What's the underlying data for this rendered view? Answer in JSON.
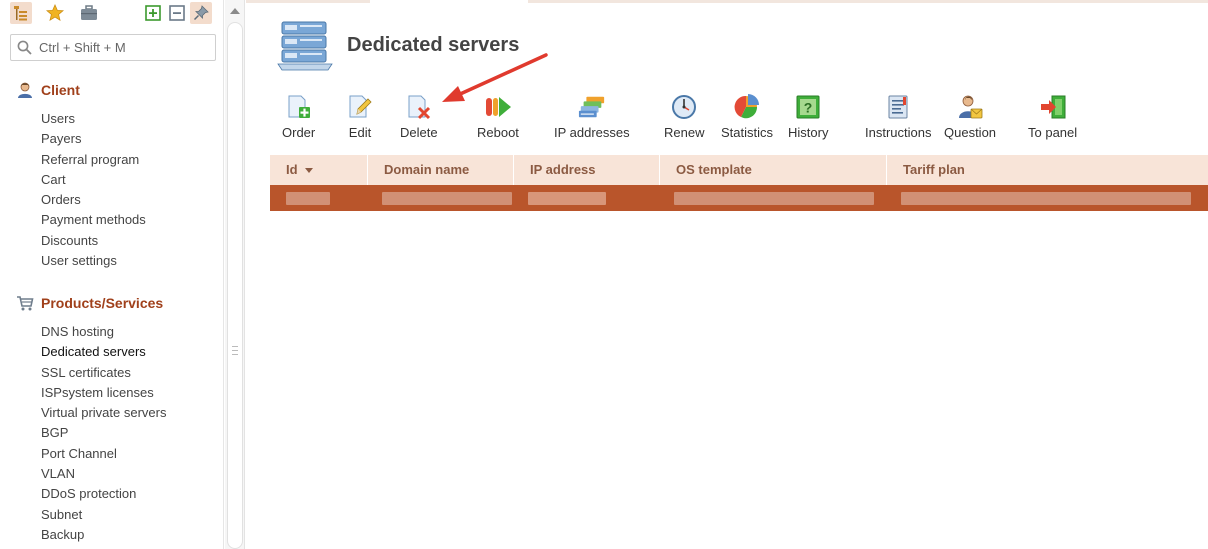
{
  "sidebar": {
    "search": {
      "placeholder": "Ctrl + Shift + M"
    },
    "toolbar_icons": [
      "tree-icon",
      "star-icon",
      "briefcase-icon",
      "expand-all-icon",
      "collapse-all-icon",
      "pin-icon"
    ],
    "sections": [
      {
        "title": "Client",
        "icon": "user-icon",
        "items": [
          "Users",
          "Payers",
          "Referral program",
          "Cart",
          "Orders",
          "Payment methods",
          "Discounts",
          "User settings"
        ]
      },
      {
        "title": "Products/Services",
        "icon": "cart-icon",
        "items": [
          "DNS hosting",
          "Dedicated servers",
          "SSL certificates",
          "ISPsystem licenses",
          "Virtual private servers",
          "BGP",
          "Port Channel",
          "VLAN",
          "DDoS protection",
          "Subnet",
          "Backup"
        ],
        "selected": "Dedicated servers"
      }
    ]
  },
  "page": {
    "title": "Dedicated servers",
    "icon": "server-rack-icon"
  },
  "toolbar": [
    {
      "label": "Order",
      "icon": "order-add-icon"
    },
    {
      "label": "Edit",
      "icon": "edit-icon"
    },
    {
      "label": "Delete",
      "icon": "delete-icon"
    },
    {
      "label": "Reboot",
      "icon": "reboot-icon"
    },
    {
      "label": "IP addresses",
      "icon": "ip-addresses-icon"
    },
    {
      "label": "Renew",
      "icon": "renew-icon"
    },
    {
      "label": "Statistics",
      "icon": "statistics-icon"
    },
    {
      "label": "History",
      "icon": "history-icon"
    },
    {
      "label": "Instructions",
      "icon": "instructions-icon"
    },
    {
      "label": "Question",
      "icon": "question-icon"
    },
    {
      "label": "To panel",
      "icon": "to-panel-icon"
    }
  ],
  "table": {
    "columns": [
      "Id",
      "Domain name",
      "IP address",
      "OS template",
      "Tariff plan"
    ],
    "sorted_column": "Id",
    "rows": [
      {
        "selected": true
      }
    ]
  },
  "colors": {
    "accent": "#a0401b",
    "header_bg": "#f8e4d8",
    "header_text": "#8b5a42",
    "selected_row": "#b9552b",
    "annotation_arrow": "#e03a2e"
  }
}
